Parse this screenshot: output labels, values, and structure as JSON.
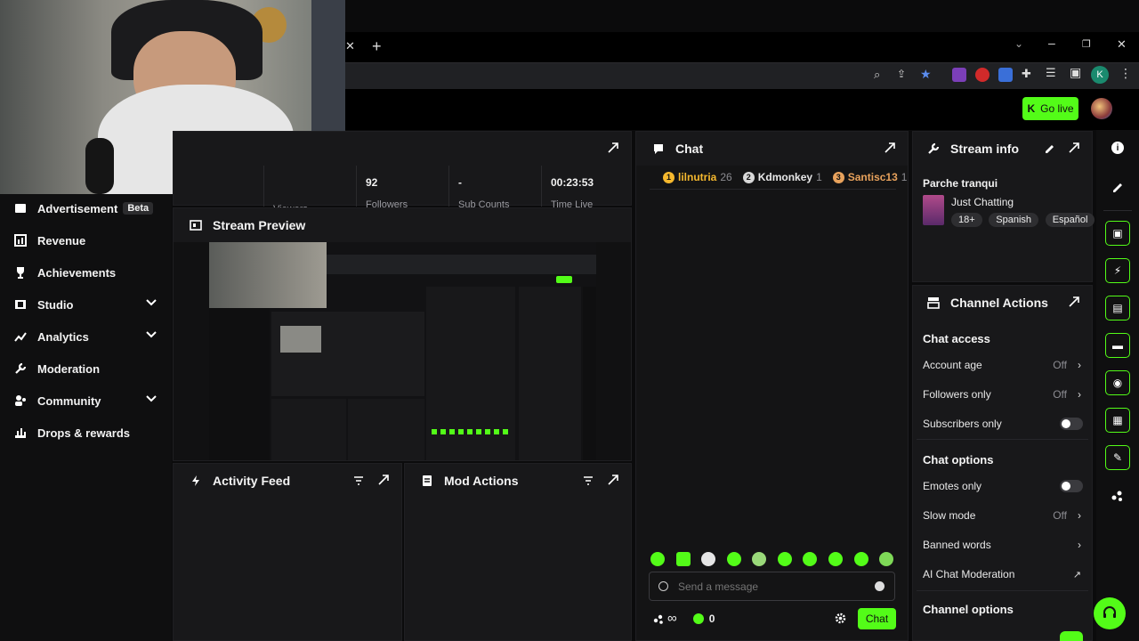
{
  "browser": {
    "tab_close": "✕",
    "new_tab": "+",
    "profile_initial": "K"
  },
  "header": {
    "go_live_label": "Go live",
    "accent": "#53fc18"
  },
  "sidebar": {
    "items": [
      {
        "label": "Advertisement",
        "badge": "Beta",
        "icon": "megaphone-icon"
      },
      {
        "label": "Revenue",
        "icon": "chart-icon"
      },
      {
        "label": "Achievements",
        "icon": "trophy-icon"
      },
      {
        "label": "Studio",
        "icon": "film-icon",
        "expandable": true
      },
      {
        "label": "Analytics",
        "icon": "analytics-icon",
        "expandable": true
      },
      {
        "label": "Moderation",
        "icon": "wrench-icon"
      },
      {
        "label": "Community",
        "icon": "people-icon",
        "expandable": true
      },
      {
        "label": "Drops & rewards",
        "icon": "gift-icon"
      }
    ]
  },
  "stats": [
    {
      "value": "92",
      "label": "Followers"
    },
    {
      "value": "-",
      "label": "Sub Counts"
    },
    {
      "value": "00:23:53",
      "label": "Time Live"
    }
  ],
  "stats_partial": {
    "viewers_label": "Viewers"
  },
  "stream_preview": {
    "title": "Stream Preview"
  },
  "activity_feed": {
    "title": "Activity Feed"
  },
  "mod_actions": {
    "title": "Mod Actions"
  },
  "chat": {
    "title": "Chat",
    "top_chatters": [
      {
        "rank": "1",
        "name": "lilnutria",
        "count": "26",
        "color": "#f5b82e"
      },
      {
        "rank": "2",
        "name": "Kdmonkey",
        "count": "1",
        "color": "#e8e8e8"
      },
      {
        "rank": "3",
        "name": "Santisc13",
        "count": "1",
        "color": "#e8a25c"
      }
    ],
    "input_placeholder": "Send a message",
    "infinity": "∞",
    "points": "0",
    "send_label": "Chat"
  },
  "stream_info": {
    "title": "Stream info",
    "stream_title": "Parche tranqui",
    "category": "Just Chatting",
    "tags": [
      "18+",
      "Spanish",
      "Español"
    ]
  },
  "channel_actions": {
    "title": "Channel Actions",
    "chat_access_title": "Chat access",
    "account_age": {
      "label": "Account age",
      "value": "Off"
    },
    "followers_only": {
      "label": "Followers only",
      "value": "Off"
    },
    "subscribers_only": {
      "label": "Subscribers only"
    },
    "chat_options_title": "Chat options",
    "emotes_only": {
      "label": "Emotes only"
    },
    "slow_mode": {
      "label": "Slow mode",
      "value": "Off"
    },
    "banned_words": {
      "label": "Banned words"
    },
    "ai_moderation": {
      "label": "AI Chat Moderation"
    },
    "channel_options_title": "Channel options"
  }
}
